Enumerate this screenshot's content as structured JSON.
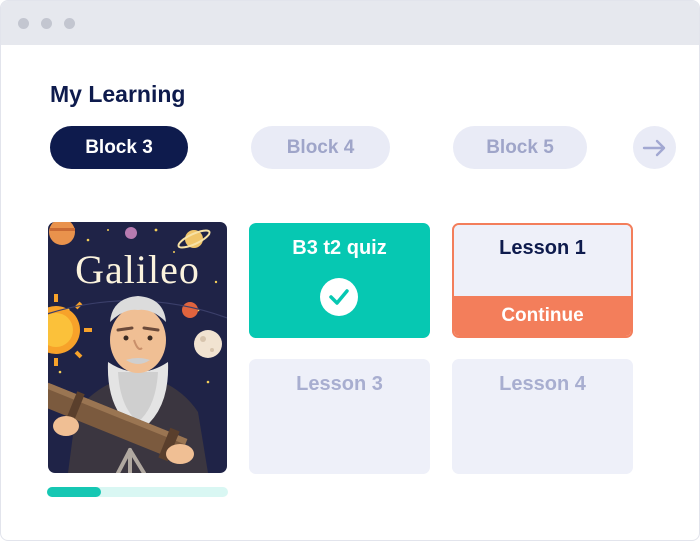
{
  "page": {
    "title": "My Learning"
  },
  "blocks": [
    {
      "label": "Block 3",
      "active": true
    },
    {
      "label": "Block 4",
      "active": false
    },
    {
      "label": "Block 5",
      "active": false
    }
  ],
  "next_icon": "arrow-right-icon",
  "book": {
    "title": "Galileo",
    "progress": 0.3
  },
  "cards": {
    "quiz": {
      "title": "B3 t2 quiz",
      "status": "completed",
      "icon": "check-circle-icon"
    },
    "lesson1": {
      "title": "Lesson 1",
      "action": "Continue"
    },
    "lesson3": {
      "title": "Lesson 3",
      "status": "locked"
    },
    "lesson4": {
      "title": "Lesson 4",
      "status": "locked"
    }
  },
  "colors": {
    "navy": "#0e1b4d",
    "teal": "#06c8b2",
    "orange": "#f37e5b",
    "pale": "#eef0f9"
  }
}
